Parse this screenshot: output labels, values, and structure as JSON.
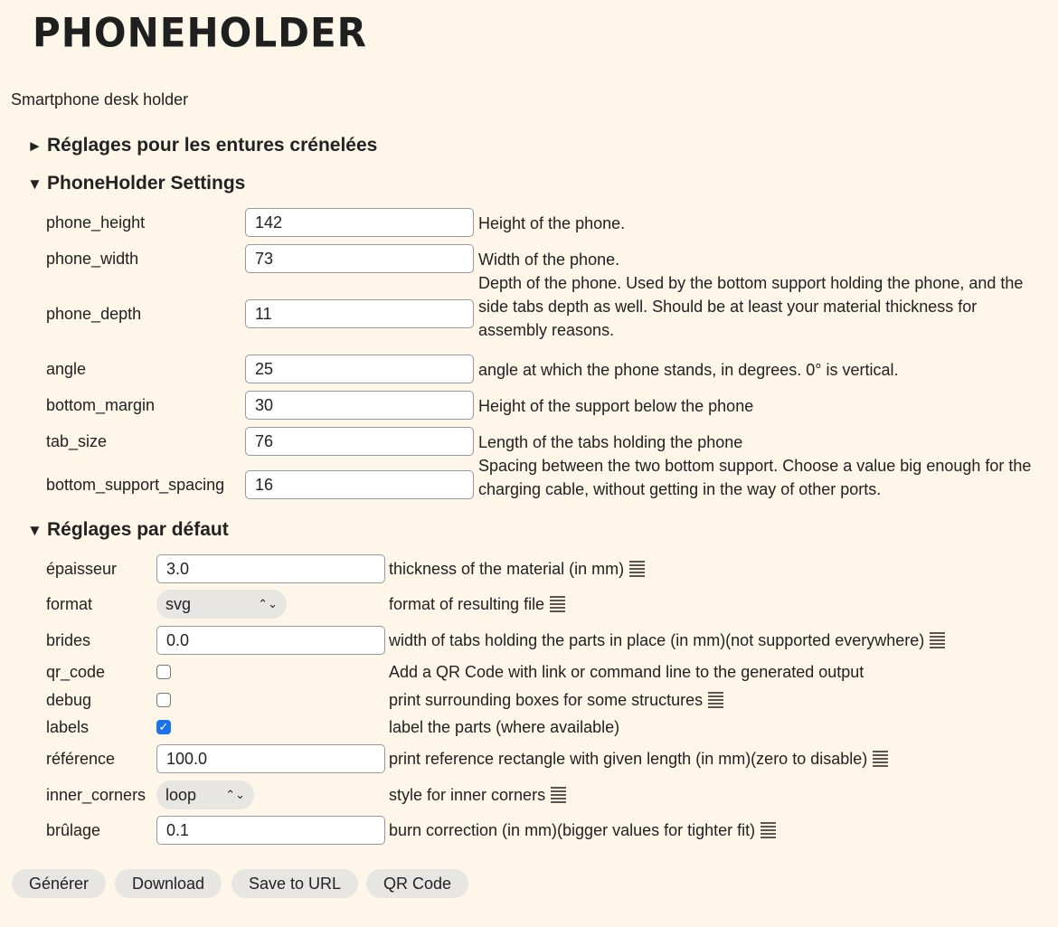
{
  "title": "PhoneHolder",
  "description": "Smartphone desk holder",
  "sections": [
    {
      "label": "Réglages pour les entures crénelées",
      "expanded": false,
      "arrow": "►"
    },
    {
      "label": "PhoneHolder Settings",
      "expanded": true,
      "arrow": "▼"
    },
    {
      "label": "Réglages par défaut",
      "expanded": true,
      "arrow": "▼"
    }
  ],
  "settings": [
    {
      "name": "phone_height",
      "value": "142",
      "help": "Height of the phone."
    },
    {
      "name": "phone_width",
      "value": "73",
      "help": "Width of the phone."
    },
    {
      "name": "phone_depth",
      "value": "11",
      "help": "Depth of the phone. Used by the bottom support holding the phone, and the side tabs depth as well. Should be at least your material thickness for assembly reasons."
    },
    {
      "name": "angle",
      "value": "25",
      "help": "angle at which the phone stands, in degrees. 0° is vertical."
    },
    {
      "name": "bottom_margin",
      "value": "30",
      "help": "Height of the support below the phone"
    },
    {
      "name": "tab_size",
      "value": "76",
      "help": "Length of the tabs holding the phone"
    },
    {
      "name": "bottom_support_spacing",
      "value": "16",
      "help": "Spacing between the two bottom support. Choose a value big enough for the charging cable, without getting in the way of other ports."
    }
  ],
  "defaults": [
    {
      "name": "épaisseur",
      "type": "text",
      "value": "3.0",
      "help": "thickness of the material (in mm)",
      "menu": true
    },
    {
      "name": "format",
      "type": "select",
      "value": "svg",
      "help": "format of resulting file",
      "menu": true
    },
    {
      "name": "brides",
      "type": "text",
      "value": "0.0",
      "help": "width of tabs holding the parts in place (in mm)(not supported everywhere)",
      "menu": true
    },
    {
      "name": "qr_code",
      "type": "checkbox",
      "checked": false,
      "help": "Add a QR Code with link or command line to the generated output",
      "menu": false
    },
    {
      "name": "debug",
      "type": "checkbox",
      "checked": false,
      "help": "print surrounding boxes for some structures",
      "menu": true
    },
    {
      "name": "labels",
      "type": "checkbox",
      "checked": true,
      "help": "label the parts (where available)",
      "menu": false
    },
    {
      "name": "référence",
      "type": "text",
      "value": "100.0",
      "help": "print reference rectangle with given length (in mm)(zero to disable)",
      "menu": true
    },
    {
      "name": "inner_corners",
      "type": "select",
      "value": "loop",
      "help": "style for inner corners",
      "menu": true
    },
    {
      "name": "brûlage",
      "type": "text",
      "value": "0.1",
      "help": "burn correction (in mm)(bigger values for tighter fit)",
      "menu": true
    }
  ],
  "buttons": [
    "Générer",
    "Download",
    "Save to URL",
    "QR Code"
  ],
  "colors": {
    "background": "#fdf6e9",
    "checkbox": "#1a73e8"
  }
}
